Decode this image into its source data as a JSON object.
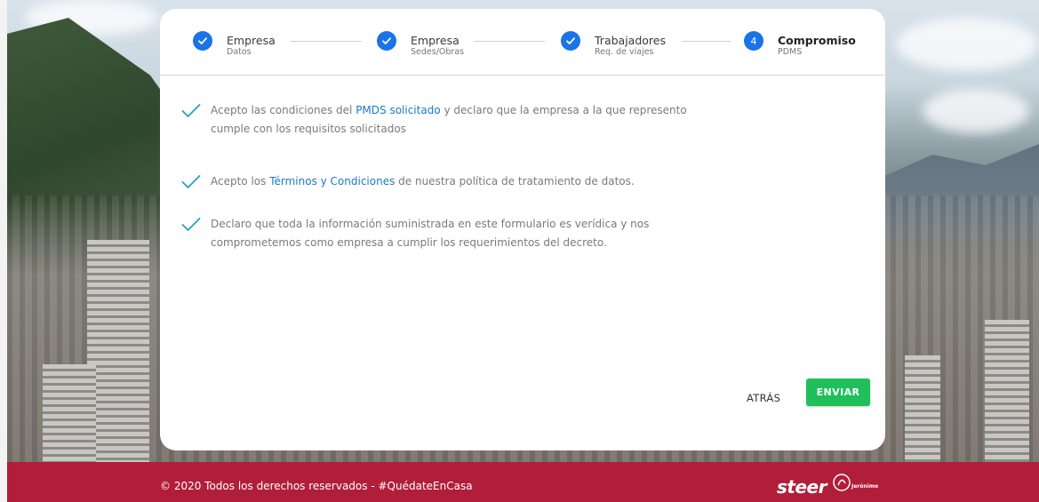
{
  "stepper": {
    "steps": [
      {
        "title": "Empresa",
        "subtitle": "Datos",
        "status": "completed"
      },
      {
        "title": "Empresa",
        "subtitle": "Sedes/Obras",
        "status": "completed"
      },
      {
        "title": "Trabajadores",
        "subtitle": "Req. de viajes",
        "status": "completed"
      },
      {
        "title": "Compromiso",
        "subtitle": "PDMS",
        "status": "active",
        "number": "4"
      }
    ]
  },
  "consents": [
    {
      "before": "Acepto las condiciones del ",
      "link": "PMDS solicitado",
      "after": " y declaro que la empresa a la que represento cumple con los requisitos solicitados",
      "checked": true
    },
    {
      "before": "Acepto los ",
      "link": "Términos y Condiciones",
      "after": " de nuestra política de tratamiento de datos.",
      "checked": true
    },
    {
      "before": "Declaro que toda la información suministrada en este formulario es verídica y nos comprometemos como empresa a cumplir los requerimientos del decreto.",
      "link": "",
      "after": "",
      "checked": true
    }
  ],
  "actions": {
    "back_label": "ATRÁS",
    "send_label": "ENVIAR"
  },
  "footer": {
    "copyright": "© 2020 Todos los derechos reservados - #QuédateEnCasa",
    "brand": "steer",
    "partner": "Jerónimo"
  },
  "colors": {
    "step_blue": "#1a73e8",
    "link_blue": "#1a7ac8",
    "check_teal": "#2a9ec4",
    "send_green": "#1fc05c",
    "footer_red": "#b11e3a"
  },
  "icons": {
    "step_done": "check-icon",
    "consent": "checkmark-icon",
    "brand": "steer-logo"
  }
}
